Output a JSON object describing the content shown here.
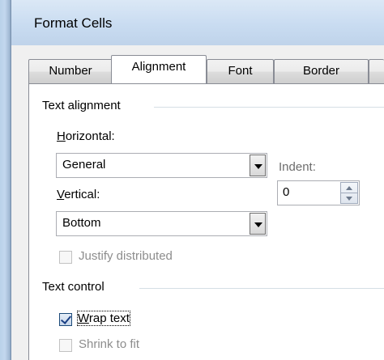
{
  "window": {
    "title": "Format Cells"
  },
  "tabs": [
    {
      "label": "Number",
      "active": false
    },
    {
      "label": "Alignment",
      "active": true
    },
    {
      "label": "Font",
      "active": false
    },
    {
      "label": "Border",
      "active": false
    }
  ],
  "text_alignment": {
    "group_label": "Text alignment",
    "horizontal": {
      "label_underlined": "H",
      "label_rest": "orizontal:",
      "value": "General"
    },
    "indent": {
      "label": "Indent:",
      "value": "0"
    },
    "vertical": {
      "label_underlined": "V",
      "label_rest": "ertical:",
      "value": "Bottom"
    },
    "justify_distributed": {
      "label": "Justify distributed",
      "checked": false,
      "enabled": false
    }
  },
  "text_control": {
    "group_label": "Text control",
    "wrap_text": {
      "label_underlined": "W",
      "label_rest": "rap text",
      "checked": true,
      "enabled": true
    },
    "shrink_to_fit": {
      "label": "Shrink to fit",
      "checked": false,
      "enabled": false
    }
  }
}
